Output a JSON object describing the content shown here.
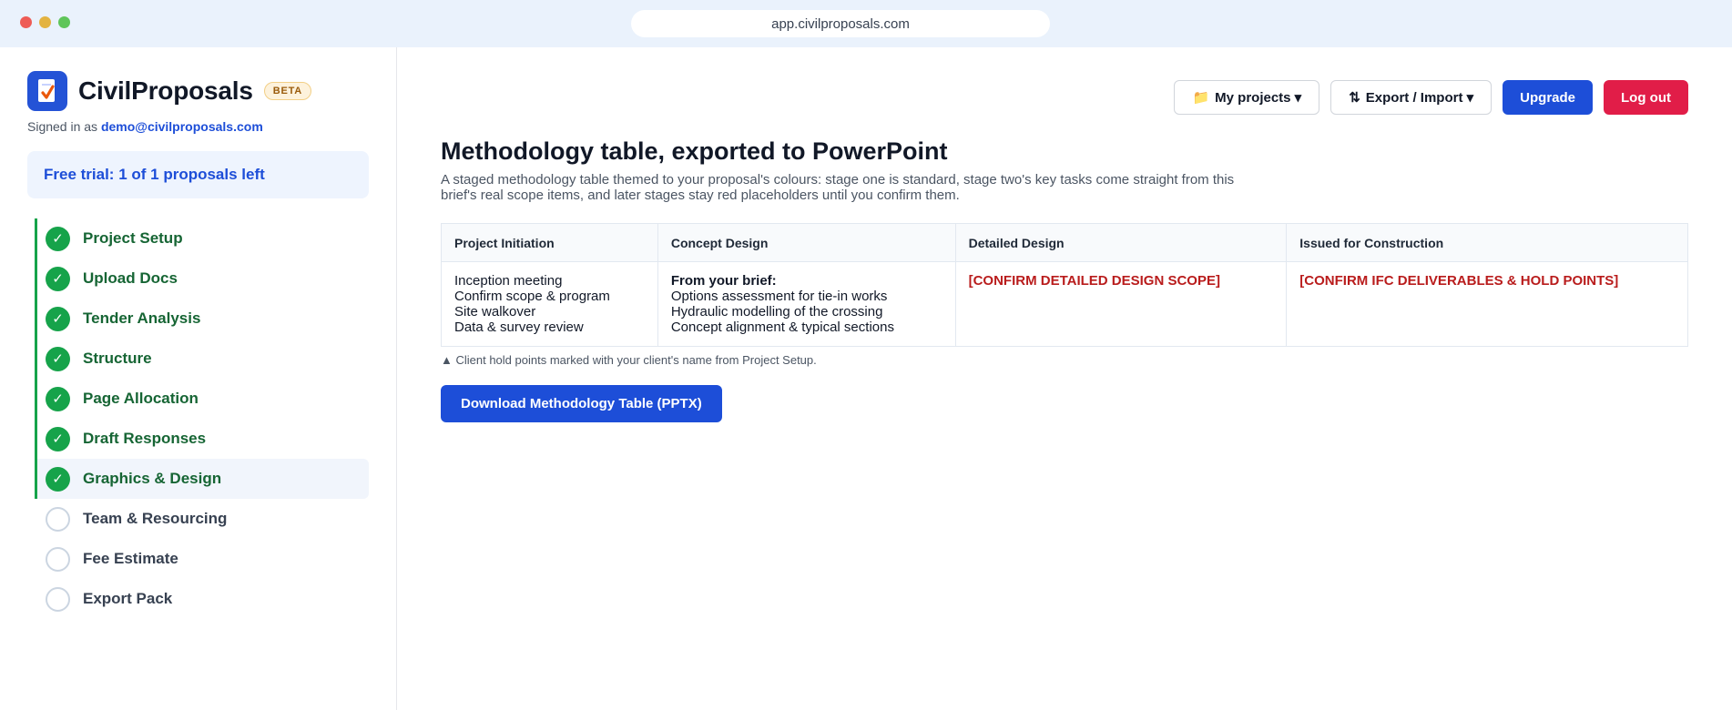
{
  "browser": {
    "url": "app.civilproposals.com"
  },
  "sidebar": {
    "brand": "CivilProposals",
    "badge": "BETA",
    "signed_in_prefix": "Signed in as",
    "email": "demo@civilproposals.com",
    "trial": "Free trial: 1 of 1 proposals left",
    "steps": [
      {
        "label": "Project Setup",
        "status": "done"
      },
      {
        "label": "Upload Docs",
        "status": "done"
      },
      {
        "label": "Tender Analysis",
        "status": "done"
      },
      {
        "label": "Structure",
        "status": "done"
      },
      {
        "label": "Page Allocation",
        "status": "done"
      },
      {
        "label": "Draft Responses",
        "status": "done"
      },
      {
        "label": "Graphics & Design",
        "status": "done",
        "active": true
      },
      {
        "label": "Team & Resourcing",
        "status": "todo"
      },
      {
        "label": "Fee Estimate",
        "status": "todo"
      },
      {
        "label": "Export Pack",
        "status": "todo"
      }
    ]
  },
  "toolbar": {
    "projects_icon": "📁",
    "projects_label": "My projects ▾",
    "export_icon": "⇅",
    "export_label": "Export / Import ▾",
    "upgrade_label": "Upgrade",
    "logout_label": "Log out"
  },
  "main": {
    "title": "Methodology table, exported to PowerPoint",
    "subtitle": "A staged methodology table themed to your proposal's colours: stage one is standard, stage two's key tasks come straight from this brief's real scope items, and later stages stay red placeholders until you confirm them.",
    "table": {
      "headers": [
        "Project Initiation",
        "Concept Design",
        "Detailed Design",
        "Issued for Construction"
      ],
      "initiation": [
        "Inception meeting",
        "Confirm scope & program",
        "Site walkover",
        "Data & survey review"
      ],
      "concept_heading": "From your brief:",
      "concept": [
        "Options assessment for tie-in works",
        "Hydraulic modelling of the crossing",
        "Concept alignment & typical sections"
      ],
      "detailed_placeholder": "[CONFIRM DETAILED DESIGN SCOPE]",
      "ifc_placeholder": "[CONFIRM IFC DELIVERABLES & HOLD POINTS]"
    },
    "note": "▲ Client hold points marked with your client's name from Project Setup.",
    "download_label": "Download Methodology Table (PPTX)"
  }
}
